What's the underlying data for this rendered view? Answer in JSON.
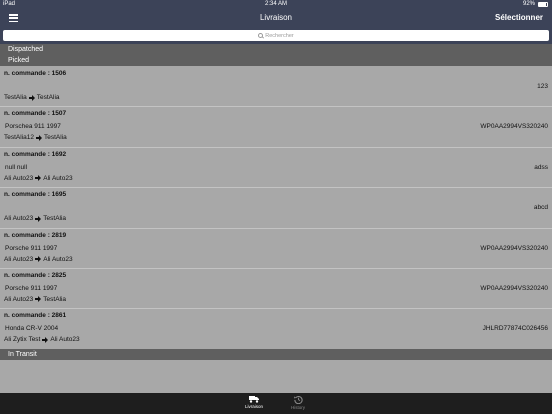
{
  "status_bar": {
    "device": "iPad",
    "time": "2:34 AM",
    "battery": "92%"
  },
  "nav": {
    "title": "Livraison",
    "select_label": "Sélectionner"
  },
  "search": {
    "placeholder": "Rechercher"
  },
  "sections": {
    "dispatched": "Dispatched",
    "picked": "Picked",
    "in_transit": "In Transit"
  },
  "orders": [
    {
      "number": "n. commande : 1506",
      "car": "",
      "code": "123",
      "from": "TestAlia",
      "to": "TestAlia"
    },
    {
      "number": "n. commande : 1507",
      "car": "Porschea 911 1997",
      "code": "WP0AA2994VS320240",
      "from": "TestAlia12",
      "to": "TestAlia"
    },
    {
      "number": "n. commande : 1692",
      "car": "null null",
      "code": "adss",
      "from": "Ali Auto23",
      "to": "Ali Auto23"
    },
    {
      "number": "n. commande : 1695",
      "car": "",
      "code": "abcd",
      "from": "Ali Auto23",
      "to": "TestAlia"
    },
    {
      "number": "n. commande : 2819",
      "car": "Porsche 911 1997",
      "code": "WP0AA2994VS320240",
      "from": "Ali Auto23",
      "to": "Ali Auto23"
    },
    {
      "number": "n. commande : 2825",
      "car": "Porsche 911 1997",
      "code": "WP0AA2994VS320240",
      "from": "Ali Auto23",
      "to": "TestAlia"
    },
    {
      "number": "n. commande : 2861",
      "car": "Honda CR-V 2004",
      "code": "JHLRD77874C026456",
      "from": "Ali Zytix Test",
      "to": "Ali Auto23"
    }
  ],
  "tabs": [
    {
      "label": "Livraison",
      "icon": "truck-icon",
      "active": true
    },
    {
      "label": "History",
      "icon": "history-icon",
      "active": false
    }
  ],
  "colors": {
    "header_bg": "#3c4358",
    "list_bg": "#a8a8a8",
    "section_bg": "#5f5f5f",
    "tab_bg": "#1e1e1e"
  }
}
